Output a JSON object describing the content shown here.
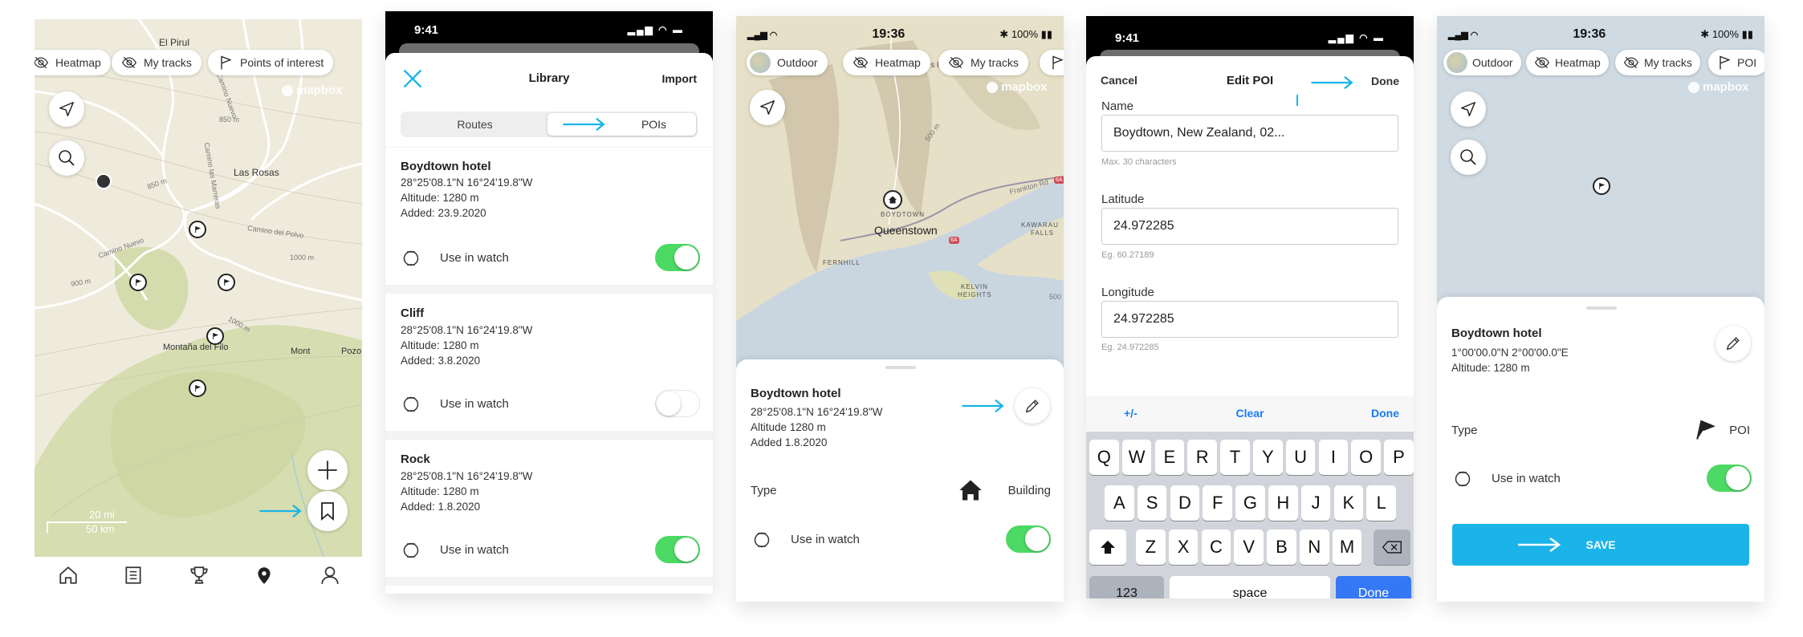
{
  "colors": {
    "accent": "#1ab4e8",
    "toggle_on": "#4cd964",
    "keyboard_done": "#3478f6",
    "ios_blue": "#1a7cf2"
  },
  "panel1": {
    "chips": [
      {
        "label": "Heatmap",
        "icon": "eye-off-icon"
      },
      {
        "label": "My tracks",
        "icon": "eye-off-icon"
      },
      {
        "label": "Points of interest",
        "icon": "flag-icon"
      }
    ],
    "attribution": "mapbox",
    "places": [
      "El Pirul",
      "Las Rosas",
      "Montaña del Filo",
      "Mont",
      "Pozo"
    ],
    "roads": [
      "Camino Nuevo",
      "Camino del Polvo",
      "Camino las Marreras",
      "Camino Nuevo"
    ],
    "contours": [
      "850 m",
      "850 m",
      "900 m",
      "1000 m",
      "1000 m"
    ],
    "scale": {
      "miles": "20 mi",
      "km": "50 km"
    },
    "nav": [
      "home-icon",
      "feed-icon",
      "trophy-icon",
      "map-pin-icon",
      "profile-icon"
    ],
    "active_nav": "map-pin-icon"
  },
  "panel2": {
    "status_time": "9:41",
    "header": {
      "title": "Library",
      "action": "Import"
    },
    "segments": [
      "Routes",
      "POIs"
    ],
    "selected_segment": "POIs",
    "items": [
      {
        "name": "Boydtown hotel",
        "coords": "28°25'08.1\"N 16°24'19.8\"W",
        "altitude": "Altitude: 1280 m",
        "added": "Added: 23.9.2020",
        "watch_label": "Use in watch",
        "use_in_watch": true
      },
      {
        "name": "Cliff",
        "coords": "28°25'08.1\"N 16°24'19.8\"W",
        "altitude": "Altitude: 1280 m",
        "added": "Added: 3.8.2020",
        "watch_label": "Use in watch",
        "use_in_watch": false
      },
      {
        "name": "Rock",
        "coords": "28°25'08.1\"N 16°24'19.8\"W",
        "altitude": "Altitude: 1280 m",
        "added": "Added: 1.8.2020",
        "watch_label": "Use in watch",
        "use_in_watch": true
      }
    ]
  },
  "panel3": {
    "status": {
      "time": "19:36",
      "battery": "100%"
    },
    "chips": [
      "Outdoor",
      "Heatmap",
      "My tracks"
    ],
    "attribution": "mapbox",
    "places": [
      "Queenstown",
      "BOYDTOWN",
      "FERNHILL",
      "KAWARAU",
      "FALLS",
      "KELVIN",
      "HEIGHTS",
      "Arthurs Point",
      "Frankton Rd",
      "6A",
      "6A",
      "500 m",
      "500"
    ],
    "poi": {
      "name": "Boydtown hotel",
      "coords": "28°25'08.1\"N 16°24'19.8\"W",
      "altitude": "Altitude 1280 m",
      "added": "Added 1.8.2020"
    },
    "type_label": "Type",
    "type_value": "Building",
    "type_icon": "house-icon",
    "watch_label": "Use in watch",
    "use_in_watch": true
  },
  "panel4": {
    "status_time": "9:41",
    "header": {
      "cancel": "Cancel",
      "title": "Edit POI",
      "done": "Done"
    },
    "fields": [
      {
        "label": "Name",
        "value": "Boydtown, New Zealand, 02...",
        "hint": "Max. 30 characters"
      },
      {
        "label": "Latitude",
        "value": "24.972285",
        "hint": "Eg. 60.27189"
      },
      {
        "label": "Longitude",
        "value": "24.972285",
        "hint": "Eg. 24.972285"
      }
    ],
    "accessory": {
      "sign": "+/-",
      "clear": "Clear",
      "done": "Done"
    },
    "keyboard": {
      "row1": [
        "Q",
        "W",
        "E",
        "R",
        "T",
        "Y",
        "U",
        "I",
        "O",
        "P"
      ],
      "row2": [
        "A",
        "S",
        "D",
        "F",
        "G",
        "H",
        "J",
        "K",
        "L"
      ],
      "row3": [
        "Z",
        "X",
        "C",
        "V",
        "B",
        "N",
        "M"
      ],
      "numbers": "123",
      "space": "space",
      "done": "Done"
    }
  },
  "panel5": {
    "status": {
      "time": "19:36",
      "battery": "100%"
    },
    "chips": [
      "Outdoor",
      "Heatmap",
      "My tracks",
      "POI"
    ],
    "attribution": "mapbox",
    "poi": {
      "name": "Boydtown hotel",
      "coords": "1°00'00.0\"N 2°00'00.0\"E",
      "altitude": "Altitude: 1280 m"
    },
    "type_label": "Type",
    "type_value": "POI",
    "type_icon": "flag-icon",
    "watch_label": "Use in watch",
    "use_in_watch": true,
    "save": "SAVE"
  }
}
